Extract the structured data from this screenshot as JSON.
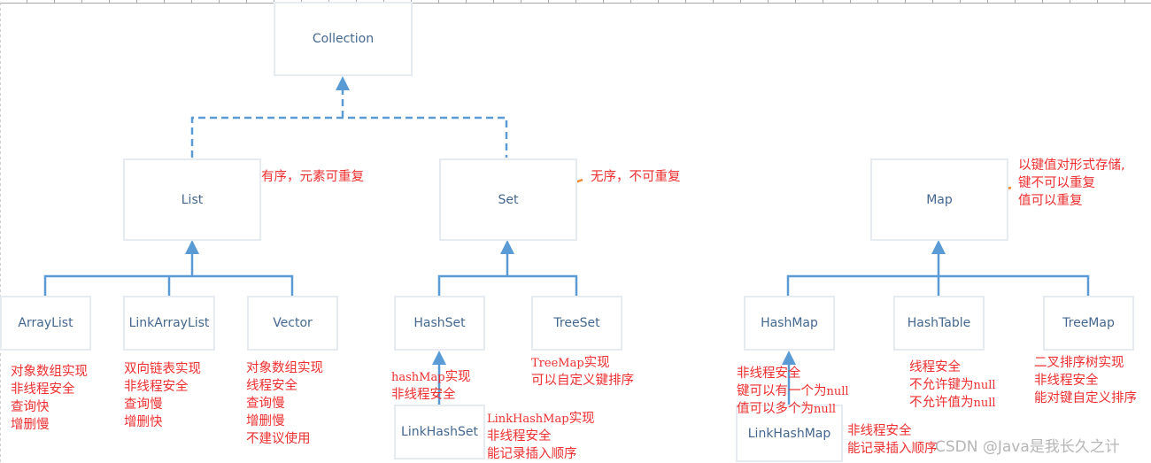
{
  "colors": {
    "box_text": "#44678f",
    "box_border": "#e6ebf2",
    "connector": "#5b9bd5",
    "annotation_arrow": "#f2872d",
    "note_text": "#ee2f2f"
  },
  "nodes": {
    "collection": "Collection",
    "list": "List",
    "set": "Set",
    "map": "Map",
    "arraylist": "ArrayList",
    "linkarraylist": "LinkArrayList",
    "vector": "Vector",
    "hashset": "HashSet",
    "treeset": "TreeSet",
    "linkhashset": "LinkHashSet",
    "hashmap": "HashMap",
    "hashtable": "HashTable",
    "treemap": "TreeMap",
    "linkhashmap": "LinkHashMap"
  },
  "notes": {
    "list": [
      "有序，元素可重复"
    ],
    "set": [
      "无序，不可重复"
    ],
    "map": [
      "以键值对形式存储,",
      "键不可以重复",
      "值可以重复"
    ],
    "arraylist": [
      "对象数组实现",
      "非线程安全",
      "查询快",
      "增删慢"
    ],
    "linkarraylist": [
      "双向链表实现",
      "非线程安全",
      "查询慢",
      "增删快"
    ],
    "vector": [
      "对象数组实现",
      "线程安全",
      "查询慢",
      "增删慢",
      "不建议使用"
    ],
    "hashset": [
      {
        "mono": "hashMap",
        "text": "实现"
      },
      {
        "mono": "",
        "text": "非线程安全"
      }
    ],
    "treeset": [
      {
        "mono": "TreeMap",
        "text": "实现"
      },
      {
        "mono": "",
        "text": "可以自定义键排序"
      }
    ],
    "linkhashset": [
      {
        "mono": "LinkHashMap",
        "text": "实现"
      },
      {
        "mono": "",
        "text": "非线程安全"
      },
      {
        "mono": "",
        "text": "能记录插入顺序"
      }
    ],
    "hashmap": [
      {
        "text": "非线程安全",
        "mono": ""
      },
      {
        "text": "键可以有一个为",
        "mono": "null"
      },
      {
        "text": "值可以多个为",
        "mono": "null"
      }
    ],
    "hashtable": [
      {
        "text": "线程安全",
        "mono": ""
      },
      {
        "text": "不允许键为",
        "mono": "null"
      },
      {
        "text": "不允许值为",
        "mono": "null"
      }
    ],
    "treemap": [
      "二叉排序树实现",
      "非线程安全",
      "能对键自定义排序"
    ],
    "linkhashmap": [
      "非线程安全",
      "能记录插入顺序"
    ]
  },
  "watermark": "CSDN @Java是我长久之计"
}
